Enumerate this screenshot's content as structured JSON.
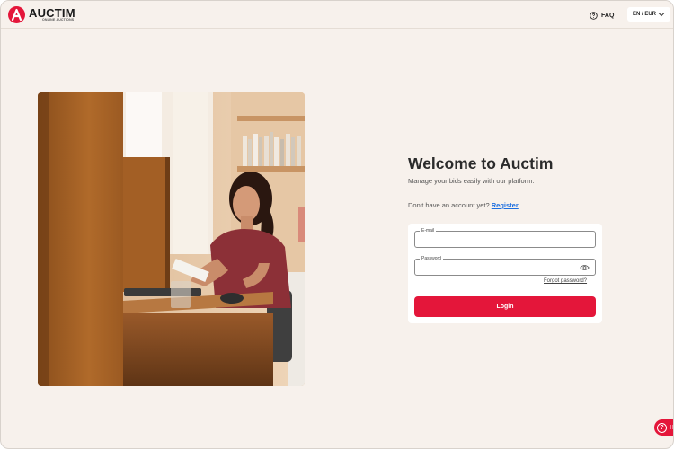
{
  "header": {
    "brand": "AUCTIM",
    "brand_sub": "ONLINE AUCTIONS",
    "faq_label": "FAQ",
    "language": "EN / EUR"
  },
  "login": {
    "title": "Welcome to Auctim",
    "subtitle": "Manage your bids easily with our platform.",
    "no_account_text": "Don't have an account yet?",
    "register_label": "Register",
    "email_label": "E-mail",
    "email_value": "",
    "password_label": "Password",
    "password_value": "",
    "forgot_label": "Forgot password?",
    "login_label": "Login"
  },
  "help": {
    "label": "He"
  },
  "colors": {
    "accent": "#e4163a",
    "background": "#f7f1ec",
    "link": "#1d6fe0"
  },
  "icons": {
    "faq": "question-circle-icon",
    "language": "chevron-down-icon",
    "password": "eye-icon"
  }
}
